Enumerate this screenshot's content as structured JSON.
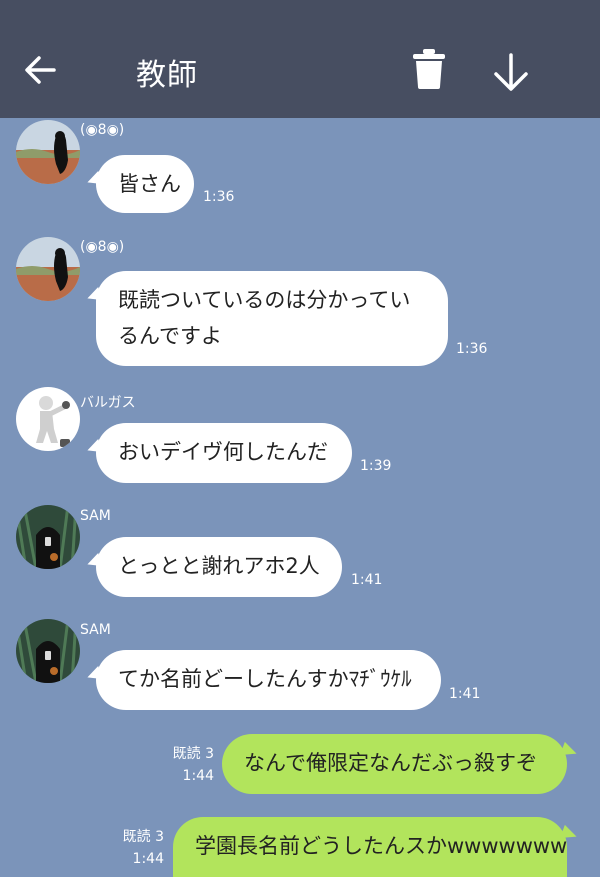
{
  "header": {
    "title": "教師",
    "back_icon": "arrow-left-icon",
    "trash_icon": "trash-icon",
    "download_icon": "arrow-down-icon"
  },
  "messages": [
    {
      "sender": "(◉8◉)",
      "text": "皆さん",
      "time": "1:36",
      "avatar": "crow-avatar"
    },
    {
      "sender": "(◉8◉)",
      "text_line1": "既読ついているのは分かってい",
      "text_line2": "るんですよ",
      "time": "1:36",
      "avatar": "crow-avatar"
    },
    {
      "sender": "バルガス",
      "text": "おいデイヴ何したんだ",
      "time": "1:39",
      "avatar": "white-figure-avatar"
    },
    {
      "sender": "SAM",
      "text": "とっとと謝れアホ2人",
      "time": "1:41",
      "avatar": "hooded-figure-avatar"
    },
    {
      "sender": "SAM",
      "text": "てか名前どーしたんすかﾏﾁﾞｳｹﾙ",
      "time": "1:41",
      "avatar": "hooded-figure-avatar"
    }
  ],
  "outgoing": [
    {
      "read": "既読 3",
      "time": "1:44",
      "text": "なんで俺限定なんだぶっ殺すぞ"
    },
    {
      "read": "既読 3",
      "time": "1:44",
      "text": "学園長名前どうしたんスかwwwwwww"
    }
  ],
  "colors": {
    "background": "#7b94ba",
    "header": "#474e61",
    "incoming_bubble": "#ffffff",
    "outgoing_bubble": "#b2e45c"
  }
}
